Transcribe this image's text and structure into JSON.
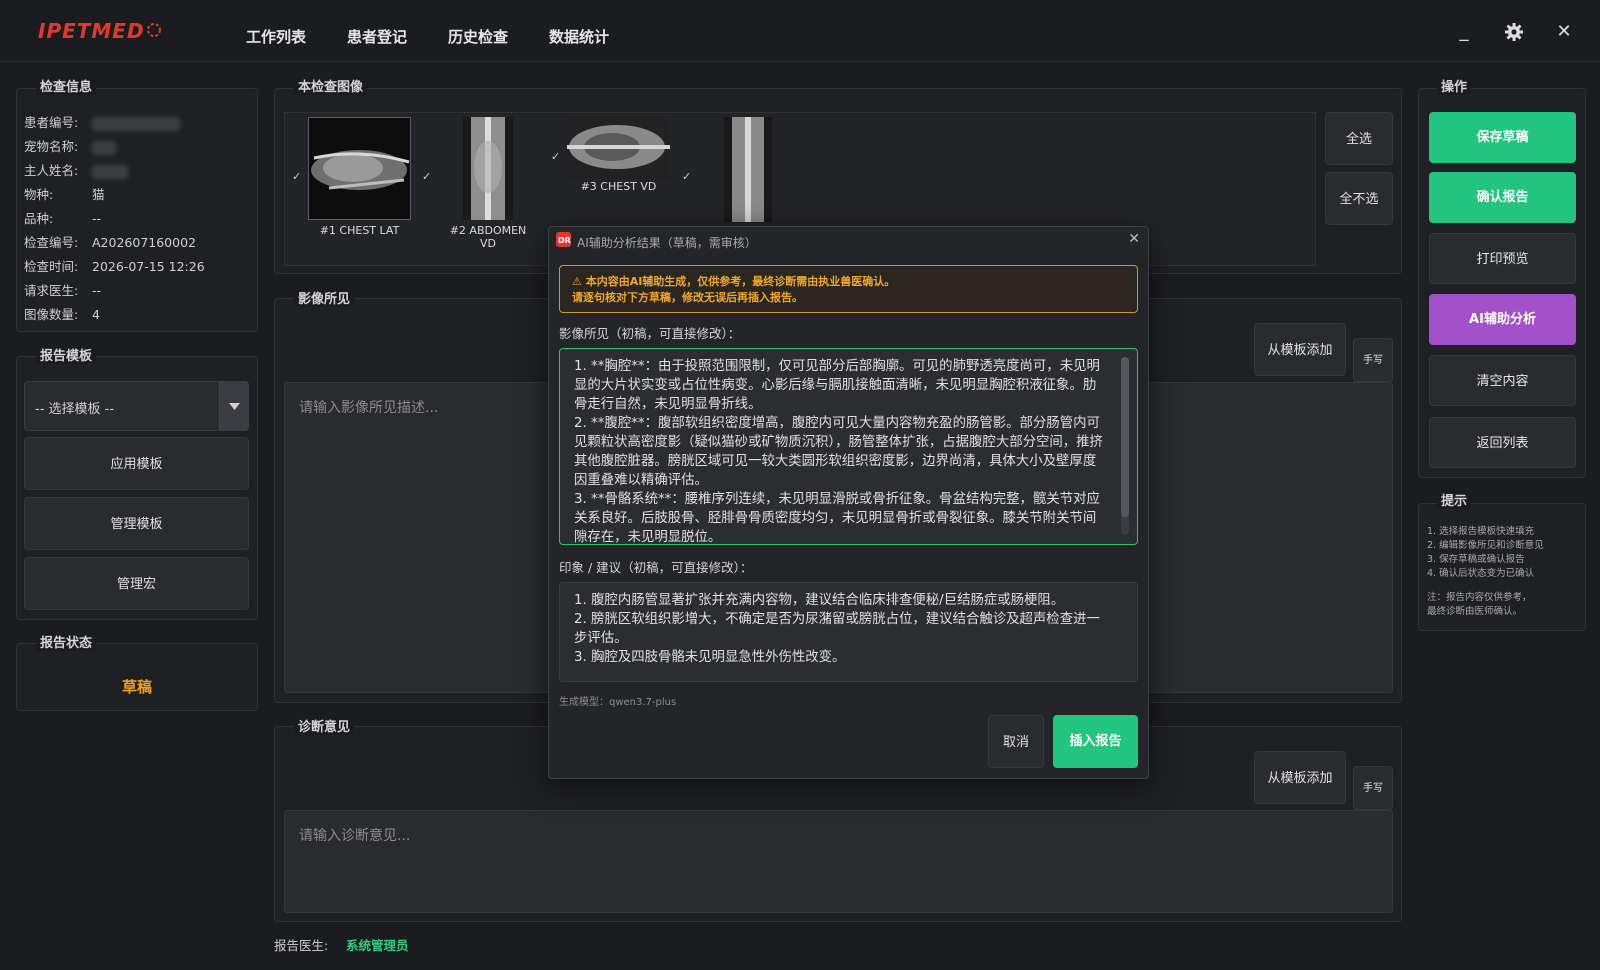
{
  "app": {
    "logo_text": "IPETMED",
    "nav": [
      "工作列表",
      "患者登记",
      "历史检查",
      "数据统计"
    ],
    "window": {
      "minimize": "_",
      "settings_icon": "gear-icon",
      "close": "✕"
    }
  },
  "exam_info": {
    "title": "检查信息",
    "rows": [
      {
        "label": "患者编号:",
        "value": ""
      },
      {
        "label": "宠物名称:",
        "value": ""
      },
      {
        "label": "主人姓名:",
        "value": ""
      },
      {
        "label": "物种:",
        "value": "猫"
      },
      {
        "label": "品种:",
        "value": "--"
      },
      {
        "label": "检查编号:",
        "value": "A202607160002"
      },
      {
        "label": "检查时间:",
        "value": "2026-07-15 12:26"
      },
      {
        "label": "请求医生:",
        "value": "--"
      },
      {
        "label": "图像数量:",
        "value": "4"
      }
    ]
  },
  "template_panel": {
    "title": "报告模板",
    "select_placeholder": "-- 选择模板 --",
    "apply": "应用模板",
    "manage": "管理模板",
    "macro": "管理宏"
  },
  "status_panel": {
    "title": "报告状态",
    "status": "草稿",
    "status_color": "#f0a020"
  },
  "images": {
    "title": "本检查图像",
    "items": [
      {
        "caption": "#1 CHEST LAT",
        "checked": true
      },
      {
        "caption": "#2 ABDOMEN VD",
        "checked": true
      },
      {
        "caption": "#3 CHEST VD",
        "checked": true
      },
      {
        "caption": "",
        "checked": true
      }
    ],
    "select_all": "全选",
    "deselect_all": "全不选"
  },
  "findings": {
    "title": "影像所见",
    "placeholder": "请输入影像所见描述...",
    "from_template": "从模板添加",
    "handwrite": "手写"
  },
  "diagnosis": {
    "title": "诊断意见",
    "placeholder": "请输入诊断意见...",
    "from_template": "从模板添加",
    "handwrite": "手写"
  },
  "doctor": {
    "label": "报告医生:",
    "name": "系统管理员",
    "name_color": "#2fc983"
  },
  "actions": {
    "title": "操作",
    "buttons": [
      {
        "label": "保存草稿",
        "color": "#22c47f"
      },
      {
        "label": "确认报告",
        "color": "#22c47f"
      },
      {
        "label": "打印预览",
        "color": "#2a2b2f"
      },
      {
        "label": "AI辅助分析",
        "color": "#a251c8"
      },
      {
        "label": "清空内容",
        "color": "#2a2b2f"
      },
      {
        "label": "返回列表",
        "color": "#2a2b2f"
      }
    ]
  },
  "tips": {
    "title": "提示",
    "lines": [
      "1. 选择报告模板快速填充",
      "2. 编辑影像所见和诊断意见",
      "3. 保存草稿或确认报告",
      "4. 确认后状态变为已确认",
      "",
      "注：报告内容仅供参考，",
      "最终诊断由医师确认。"
    ]
  },
  "modal": {
    "title": "AI辅助分析结果（草稿，需审核）",
    "warning_line1": "本内容由AI辅助生成，仅供参考，最终诊断需由执业兽医确认。",
    "warning_line2": "请逐句核对下方草稿，修改无误后再插入报告。",
    "findings_label": "影像所见（初稿，可直接修改）：",
    "findings_text": [
      "1. **胸腔**：由于投照范围限制，仅可见部分后部胸廓。可见的肺野透亮度尚可，未见明显的大片状实变或占位性病变。心影后缘与膈肌接触面清晰，未见明显胸腔积液征象。肋骨走行自然，未见明显骨折线。",
      "2. **腹腔**：腹部软组织密度增高，腹腔内可见大量内容物充盈的肠管影。部分肠管内可见颗粒状高密度影（疑似猫砂或矿物质沉积），肠管整体扩张，占据腹腔大部分空间，推挤其他腹腔脏器。膀胱区域可见一较大类圆形软组织密度影，边界尚清，具体大小及壁厚度因重叠难以精确评估。",
      "3. **骨骼系统**：腰椎序列连续，未见明显滑脱或骨折征象。骨盆结构完整，髋关节对应关系良好。后肢股骨、胫腓骨骨质密度均匀，未见明显骨折或骨裂征象。膝关节附关节间隙存在，未见明显脱位。"
    ],
    "impression_label": "印象 / 建议（初稿，可直接修改）：",
    "impression_text": [
      "1. 腹腔内肠管显著扩张并充满内容物，建议结合临床排查便秘/巨结肠症或肠梗阻。",
      "2. 膀胱区软组织影增大，不确定是否为尿潴留或膀胱占位，建议结合触诊及超声检查进一步评估。",
      "3. 胸腔及四肢骨骼未见明显急性外伤性改变。"
    ],
    "model": "生成模型：qwen3.7-plus",
    "cancel": "取消",
    "insert": "插入报告"
  }
}
